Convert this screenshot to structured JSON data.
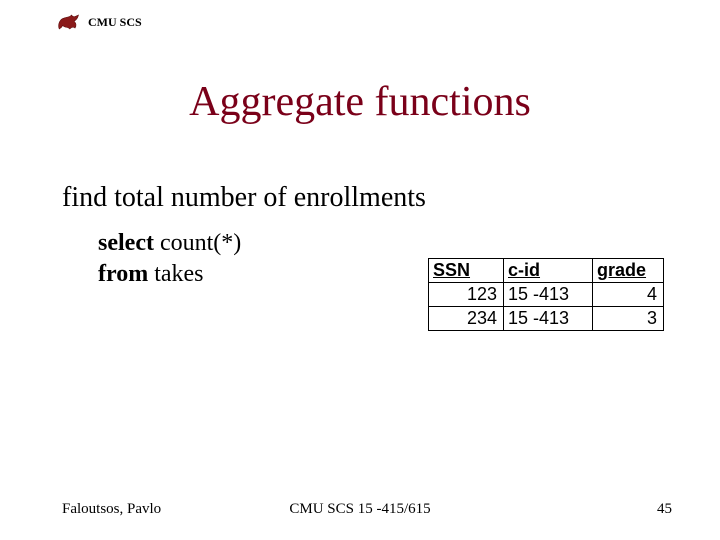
{
  "header": {
    "org": "CMU SCS"
  },
  "title": "Aggregate functions",
  "prompt": "find total number of enrollments",
  "sql": {
    "line1_kw": "select",
    "line1_rest": " count(*)",
    "line2_kw": "from",
    "line2_rest": " takes"
  },
  "table": {
    "headers": [
      "SSN",
      "c-id",
      "grade"
    ],
    "rows": [
      {
        "ssn": "123",
        "cid": "15 -413",
        "grade": "4"
      },
      {
        "ssn": "234",
        "cid": "15 -413",
        "grade": "3"
      }
    ]
  },
  "footer": {
    "authors": "Faloutsos, Pavlo",
    "course": "CMU SCS 15 -415/615",
    "page": "45"
  }
}
